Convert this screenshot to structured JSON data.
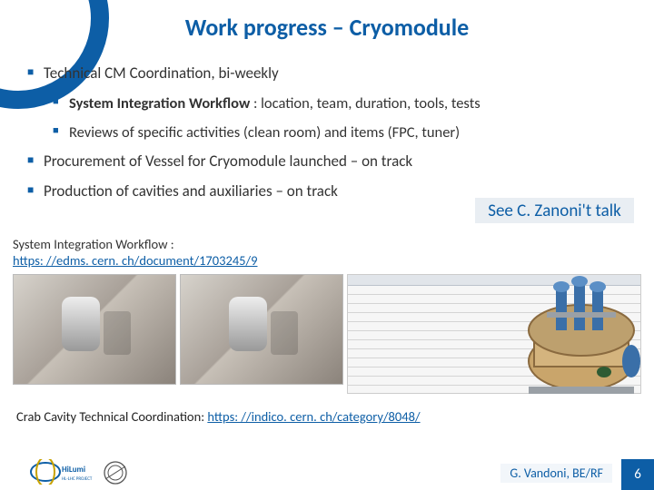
{
  "title": "Work progress – Cryomodule",
  "bullets": {
    "b1": "Technical CM Coordination, bi-weekly",
    "b1a_bold": "System Integration Workflow",
    "b1a_rest": " : location, team, duration, tools, tests",
    "b1b": "Reviews of specific activities (clean room) and items (FPC, tuner)",
    "b2": "Procurement of Vessel for Cryomodule launched – on track",
    "b3": "Production of cavities and auxiliaries – on track"
  },
  "callout": "See C. Zanoni't talk",
  "siw": {
    "label": "System Integration Workflow :",
    "url": "https: //edms. cern. ch/document/1703245/9"
  },
  "cctc": {
    "label": "Crab Cavity Technical Coordination: ",
    "url": "https: //indico. cern. ch/category/8048/"
  },
  "byline": "G. Vandoni, BE/RF",
  "pagenum": "6",
  "logos": {
    "l1": "Hi-Lumi HL-LHC Project",
    "l2": "CERN"
  }
}
